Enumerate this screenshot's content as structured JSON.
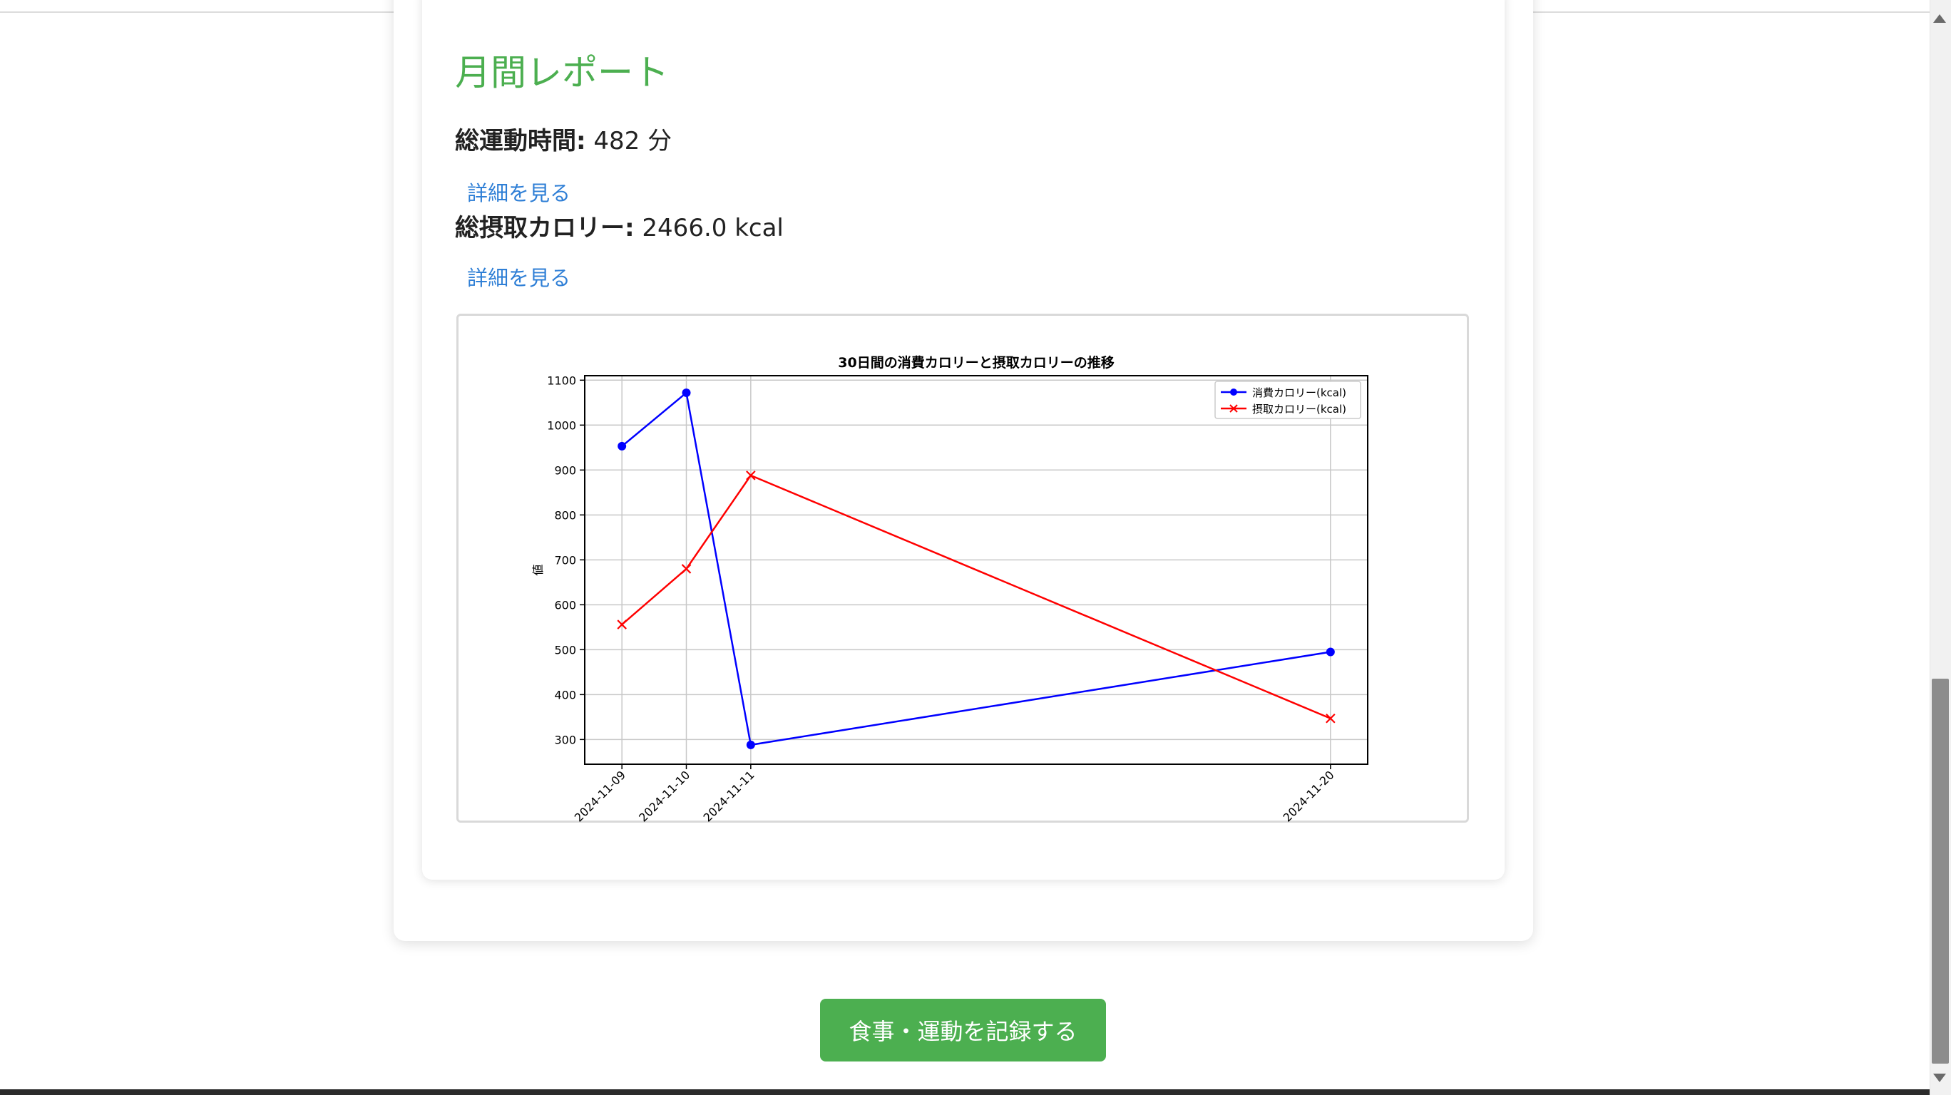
{
  "report": {
    "title": "月間レポート",
    "exercise_label": "総運動時間:",
    "exercise_value": " 482 分",
    "calorie_label": "総摂取カロリー:",
    "calorie_value": " 2466.0 kcal",
    "detail_link_label": "詳細を見る"
  },
  "actions": {
    "record_button_label": "食事・運動を記録する"
  },
  "colors": {
    "accent_green": "#4caf50",
    "link_blue": "#2f7fd6",
    "burned_series": "#0000ff",
    "intake_series": "#ff0000"
  },
  "chart_data": {
    "type": "line",
    "title": "30日間の消費カロリーと摂取カロリーの推移",
    "xlabel": "",
    "ylabel": "値",
    "x": [
      "2024-11-09",
      "2024-11-10",
      "2024-11-11",
      "2024-11-20"
    ],
    "yticks": [
      300,
      400,
      500,
      600,
      700,
      800,
      900,
      1000,
      1100
    ],
    "ylim": [
      245,
      1110
    ],
    "grid": true,
    "legend_position": "top-right",
    "series": [
      {
        "name": "消費カロリー(kcal)",
        "color": "#0000ff",
        "marker": "circle",
        "values": [
          953,
          1072,
          288,
          495
        ]
      },
      {
        "name": "摂取カロリー(kcal)",
        "color": "#ff0000",
        "marker": "x",
        "values": [
          556,
          680,
          888,
          347
        ]
      }
    ]
  }
}
